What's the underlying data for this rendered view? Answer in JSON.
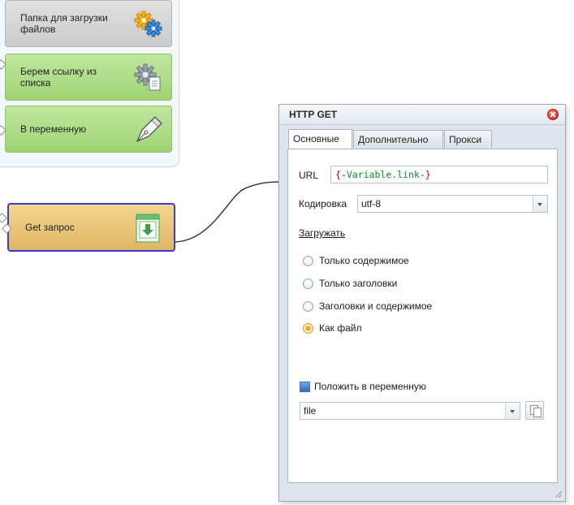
{
  "canvas": {
    "blocks": [
      {
        "label": "Папка для загрузки файлов",
        "icon": "gears-icon"
      },
      {
        "label": "Берем ссылку из списка",
        "icon": "gear-document-icon"
      },
      {
        "label": "В переменную",
        "icon": "pen-nib-icon"
      }
    ],
    "get_block": {
      "label": "Get запрос",
      "icon": "download-page-icon"
    }
  },
  "dialog": {
    "title": "HTTP GET",
    "tabs": [
      "Основные",
      "Дополнительно",
      "Прокси"
    ],
    "active_tab": "Основные",
    "url": {
      "label": "URL",
      "open": "{-",
      "variable": "Variable.link",
      "close": "-}"
    },
    "encoding": {
      "label": "Кодировка",
      "value": "utf-8"
    },
    "load_label": "Загружать",
    "load_options": [
      {
        "label": "Только содержимое",
        "selected": false
      },
      {
        "label": "Только заголовки",
        "selected": false
      },
      {
        "label": "Заголовки и содержимое",
        "selected": false
      },
      {
        "label": "Как файл",
        "selected": true
      }
    ],
    "save_to_variable": {
      "label": "Положить в переменную",
      "value": "file"
    }
  },
  "colors": {
    "gray_block": "#cbcbcb",
    "green_block": "#9fd375",
    "get_block": "#dfb565",
    "get_block_border": "#3b3bd0",
    "radio_selected": "#f6a526",
    "close_button": "#d8302a"
  }
}
